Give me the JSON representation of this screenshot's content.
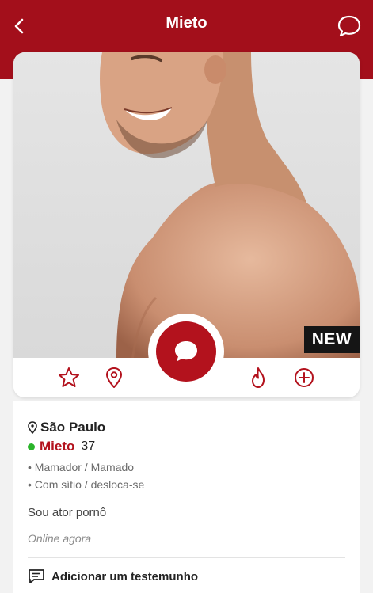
{
  "header": {
    "title": "Mieto",
    "back_icon": "chevron-left-icon",
    "chat_icon": "speech-bubble-icon"
  },
  "profile_card": {
    "badge": "NEW",
    "actions": [
      "star-icon",
      "location-pin-icon",
      "chat-bubble-icon",
      "flame-icon",
      "plus-circle-icon"
    ]
  },
  "info": {
    "location": "São Paulo",
    "name": "Mieto",
    "age": "37",
    "tags": [
      "• Mamador / Mamado",
      "• Com sítio / desloca-se"
    ],
    "bio": "Sou ator pornô",
    "status": "Online agora",
    "testimonial_label": "Adicionar um testemunho"
  },
  "colors": {
    "brand": "#a30f1b",
    "accent": "#b3121d",
    "online": "#2bb42b"
  }
}
